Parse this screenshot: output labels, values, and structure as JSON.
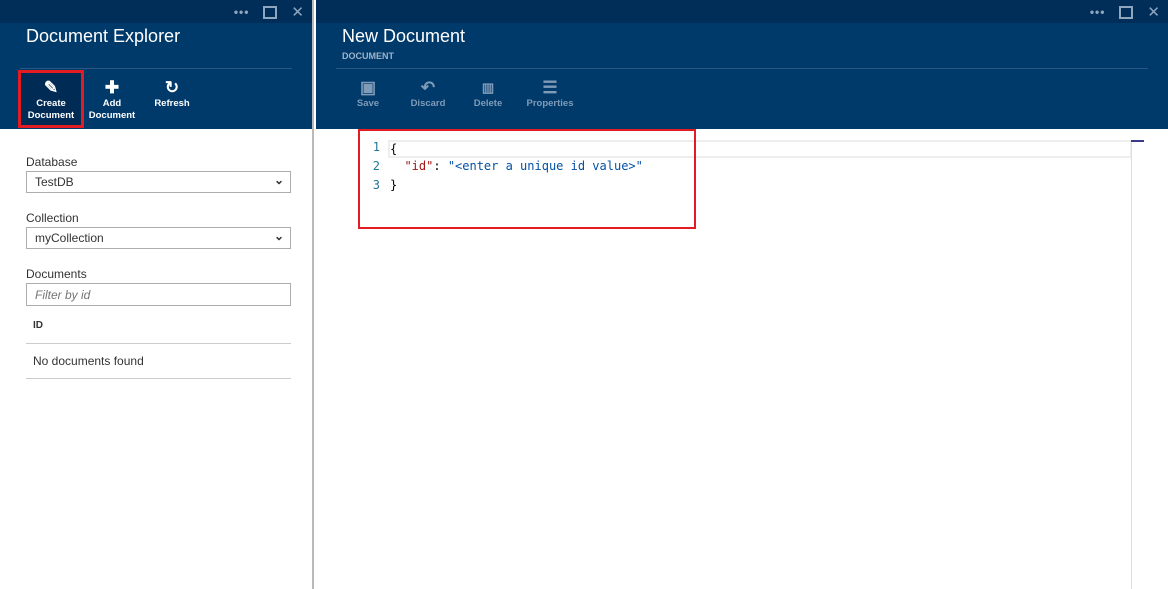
{
  "window_controls": {
    "more": "•••",
    "maximize": "maximize-icon",
    "close": "✕"
  },
  "explorer": {
    "title": "Document Explorer",
    "toolbar": [
      {
        "label_1": "Create",
        "label_2": "Document",
        "icon": "✎"
      },
      {
        "label_1": "Add",
        "label_2": "Document",
        "icon": "✚"
      },
      {
        "label_1": "Refresh",
        "label_2": "",
        "icon": "↻"
      }
    ],
    "database_label": "Database",
    "database_value": "TestDB",
    "collection_label": "Collection",
    "collection_value": "myCollection",
    "documents_label": "Documents",
    "filter_placeholder": "Filter by id",
    "id_header": "ID",
    "empty_text": "No documents found"
  },
  "editor_blade": {
    "title": "New Document",
    "subtitle": "DOCUMENT",
    "toolbar": [
      {
        "label": "Save",
        "icon": "💾"
      },
      {
        "label": "Discard",
        "icon": "↶"
      },
      {
        "label": "Delete",
        "icon": "🗑"
      },
      {
        "label": "Properties",
        "icon": "☰"
      }
    ],
    "lines": [
      {
        "n": "1",
        "text": "{"
      },
      {
        "n": "2",
        "key": "\"id\"",
        "sep": ": ",
        "value": "\"<enter a unique id value>\""
      },
      {
        "n": "3",
        "text": "}"
      }
    ]
  },
  "colors": {
    "header": "#003a6b",
    "topbar": "#002e59",
    "highlight": "#e31b23"
  }
}
